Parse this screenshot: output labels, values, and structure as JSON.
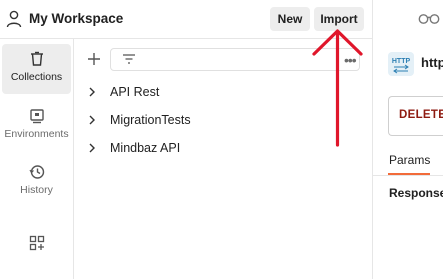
{
  "header": {
    "workspace_title": "My Workspace",
    "new_label": "New",
    "import_label": "Import"
  },
  "sidebar": {
    "items": [
      {
        "label": "Collections",
        "icon": "trash-bin-icon",
        "active": true
      },
      {
        "label": "Environments",
        "icon": "environment-icon",
        "active": false
      },
      {
        "label": "History",
        "icon": "history-clock-icon",
        "active": false
      },
      {
        "label": "",
        "icon": "add-widgets-icon",
        "active": false
      }
    ]
  },
  "collections": {
    "items": [
      {
        "name": "API Rest"
      },
      {
        "name": "MigrationTests"
      },
      {
        "name": "Mindbaz API"
      }
    ]
  },
  "request_panel": {
    "http_badge": "HTTP",
    "url_text": "http",
    "method": "DELETE",
    "tab_params": "Params",
    "response_label": "Response"
  },
  "annotation": {
    "color": "#e0162b"
  }
}
